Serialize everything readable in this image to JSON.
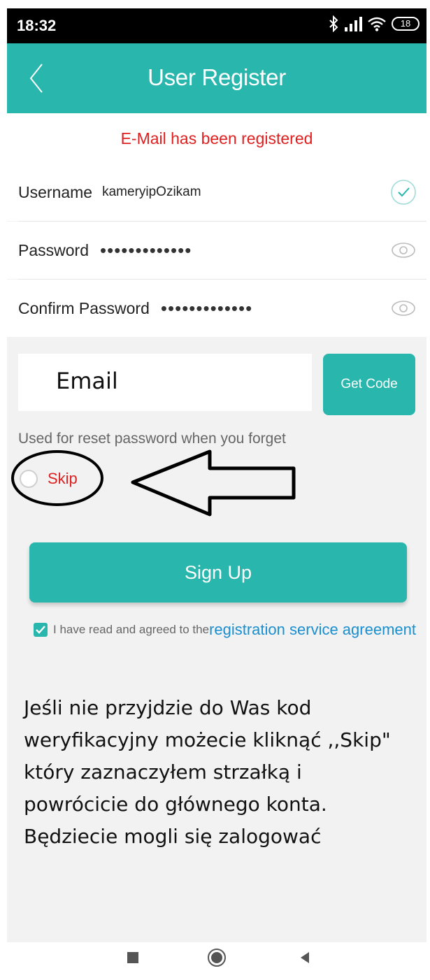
{
  "status_bar": {
    "time": "18:32",
    "battery": "18",
    "icons": [
      "bluetooth-icon",
      "signal-icon",
      "wifi-icon",
      "battery-icon"
    ]
  },
  "header": {
    "title": "User Register"
  },
  "error_message": "E-Mail has been registered",
  "form": {
    "username_label": "Username",
    "username_value": "kameryipOzikam",
    "password_label": "Password",
    "password_value": "•••••••••••••",
    "confirm_label": "Confirm Password",
    "confirm_value": "•••••••••••••"
  },
  "email": {
    "placeholder": "Email",
    "get_code": "Get Code",
    "hint": "Used for reset password when you forget"
  },
  "skip_label": "Skip",
  "signup_label": "Sign Up",
  "agreement": {
    "text": "I have read and agreed to the",
    "link": "registration service agreement",
    "checked": true
  },
  "note_lines": [
    "Jeśli nie przyjdzie do Was kod",
    "weryfikacyjny możecie kliknąć ,,Skip\"",
    "który zaznaczyłem strzałką i",
    "powrócicie do głównego konta.",
    "Będziecie mogli się zalogować"
  ],
  "colors": {
    "accent": "#28b6ad",
    "error": "#e02020",
    "link": "#1a8fd0"
  }
}
